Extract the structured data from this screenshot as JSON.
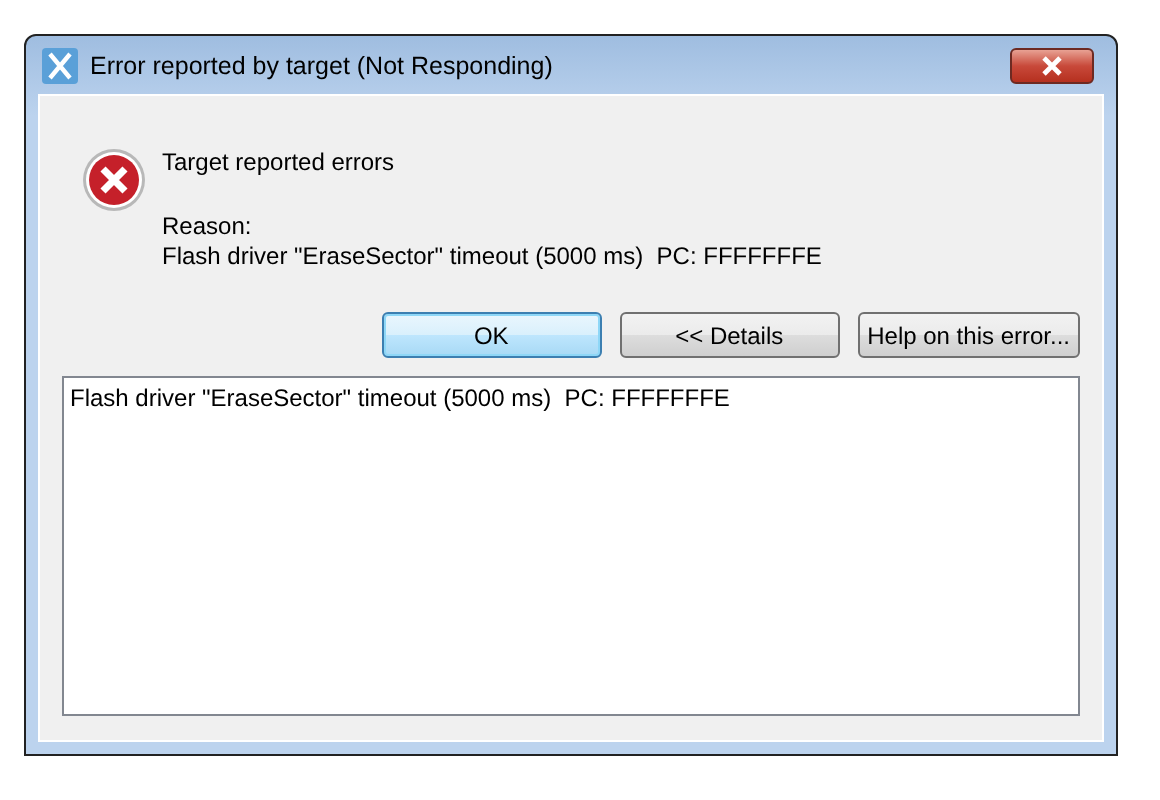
{
  "window": {
    "title": "Error reported by target (Not Responding)"
  },
  "message": {
    "heading": "Target reported errors",
    "reason_label": "Reason:",
    "reason": "Flash driver \"EraseSector\" timeout (5000 ms)  PC: FFFFFFFE"
  },
  "buttons": [
    {
      "label": "OK",
      "kind": "default"
    },
    {
      "label": "<< Details",
      "kind": "normal"
    },
    {
      "label": "Help on this error...",
      "kind": "normal"
    }
  ],
  "details": {
    "text": "Flash driver \"EraseSector\" timeout (5000 ms)  PC: FFFFFFFE"
  }
}
